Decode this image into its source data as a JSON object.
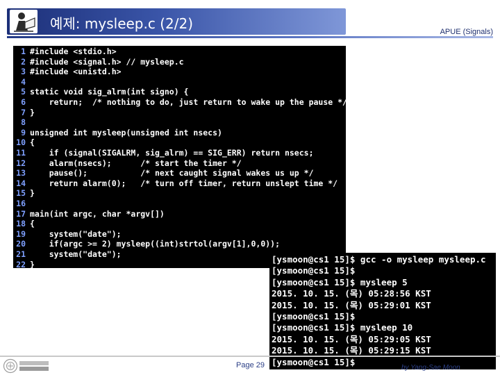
{
  "slide": {
    "title": "예제: mysleep.c (2/2)",
    "header_right": "APUE (Signals)",
    "page_label": "Page 29",
    "author": "by Yang-Sae Moon",
    "logo_text": "강원대학교 컴퓨터과학과"
  },
  "code": [
    {
      "n": "1",
      "text": "#include <stdio.h>"
    },
    {
      "n": "2",
      "text": "#include <signal.h> // mysleep.c"
    },
    {
      "n": "3",
      "text": "#include <unistd.h>"
    },
    {
      "n": "4",
      "text": ""
    },
    {
      "n": "5",
      "text": "static void sig_alrm(int signo) {"
    },
    {
      "n": "6",
      "text": "    return;  /* nothing to do, just return to wake up the pause */"
    },
    {
      "n": "7",
      "text": "}"
    },
    {
      "n": "8",
      "text": ""
    },
    {
      "n": "9",
      "text": "unsigned int mysleep(unsigned int nsecs)"
    },
    {
      "n": "10",
      "text": "{"
    },
    {
      "n": "11",
      "text": "    if (signal(SIGALRM, sig_alrm) == SIG_ERR) return nsecs;"
    },
    {
      "n": "12",
      "text": "    alarm(nsecs);      /* start the timer */"
    },
    {
      "n": "13",
      "text": "    pause();           /* next caught signal wakes us up */"
    },
    {
      "n": "14",
      "text": "    return alarm(0);   /* turn off timer, return unslept time */"
    },
    {
      "n": "15",
      "text": "}"
    },
    {
      "n": "16",
      "text": ""
    },
    {
      "n": "17",
      "text": "main(int argc, char *argv[])"
    },
    {
      "n": "18",
      "text": "{"
    },
    {
      "n": "19",
      "text": "    system(\"date\");"
    },
    {
      "n": "20",
      "text": "    if(argc >= 2) mysleep((int)strtol(argv[1],0,0));"
    },
    {
      "n": "21",
      "text": "    system(\"date\");"
    },
    {
      "n": "22",
      "text": "}"
    }
  ],
  "terminal": [
    "[ysmoon@cs1 15]$ gcc -o mysleep mysleep.c",
    "[ysmoon@cs1 15]$",
    "[ysmoon@cs1 15]$ mysleep 5",
    "2015. 10. 15. (목) 05:28:56 KST",
    "2015. 10. 15. (목) 05:29:01 KST",
    "[ysmoon@cs1 15]$",
    "[ysmoon@cs1 15]$ mysleep 10",
    "2015. 10. 15. (목) 05:29:05 KST",
    "2015. 10. 15. (목) 05:29:15 KST",
    "[ysmoon@cs1 15]$"
  ]
}
